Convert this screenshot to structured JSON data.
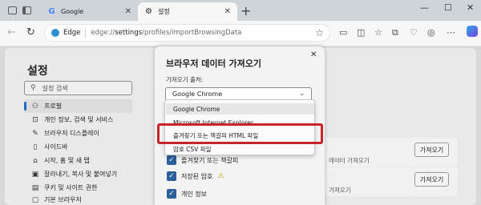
{
  "browser": {
    "tabs": [
      {
        "label": "Google",
        "icon": "google-icon",
        "active": false
      },
      {
        "label": "설정",
        "icon": "gear-icon",
        "active": true
      }
    ],
    "new_tab": "+",
    "window_controls": {
      "minimize": "—",
      "maximize": "☐",
      "close": "✕"
    },
    "address": {
      "edge_label": "Edge",
      "url_prefix": "edge://",
      "url_main": "settings",
      "url_rest": "/profiles/importBrowsingData"
    }
  },
  "settings": {
    "title": "설정",
    "search_placeholder": "설정 검색",
    "nav": [
      {
        "label": "프로필",
        "icon": "person-icon",
        "active": true
      },
      {
        "label": "개인 정보, 검색 및 서비스",
        "icon": "lock-icon",
        "active": false
      },
      {
        "label": "브라우저 디스플레이",
        "icon": "brush-icon",
        "active": false
      },
      {
        "label": "사이드바",
        "icon": "sidebar-icon",
        "active": false
      },
      {
        "label": "시작, 홈 및 새 탭",
        "icon": "home-icon",
        "active": false
      },
      {
        "label": "잘라내기, 복사 및 붙여넣기",
        "icon": "clipboard-icon",
        "active": false
      },
      {
        "label": "쿠키 및 사이트 권한",
        "icon": "cookie-icon",
        "active": false
      },
      {
        "label": "기본 브라우저",
        "icon": "browser-icon",
        "active": false
      }
    ],
    "right_panel": {
      "import_button": "가져오기",
      "row1_text": "데이터 가져오기",
      "row2_text": "가져오기"
    }
  },
  "dialog": {
    "title": "브라우저 데이터 가져오기",
    "source_label": "가져오기 출처:",
    "selected_value": "Google Chrome",
    "close": "✕",
    "dropdown_options": [
      {
        "label": "Google Chrome",
        "selected": true
      },
      {
        "label": "Microsoft Internet Explorer",
        "selected": false
      },
      {
        "label": "즐겨찾기 또는 책갈피 HTML 파일",
        "selected": false
      },
      {
        "label": "암호 CSV 파일",
        "selected": false
      }
    ],
    "checkboxes": [
      {
        "label": "즐겨찾기 또는 책갈피",
        "checked": true
      },
      {
        "label": "저장된 암호",
        "checked": true,
        "warning": true
      },
      {
        "label": "개인 정보",
        "checked": true
      }
    ]
  },
  "colors": {
    "highlight": "#c8242a",
    "accent": "#1a6fc0",
    "checkbox": "#2b5f9a"
  }
}
